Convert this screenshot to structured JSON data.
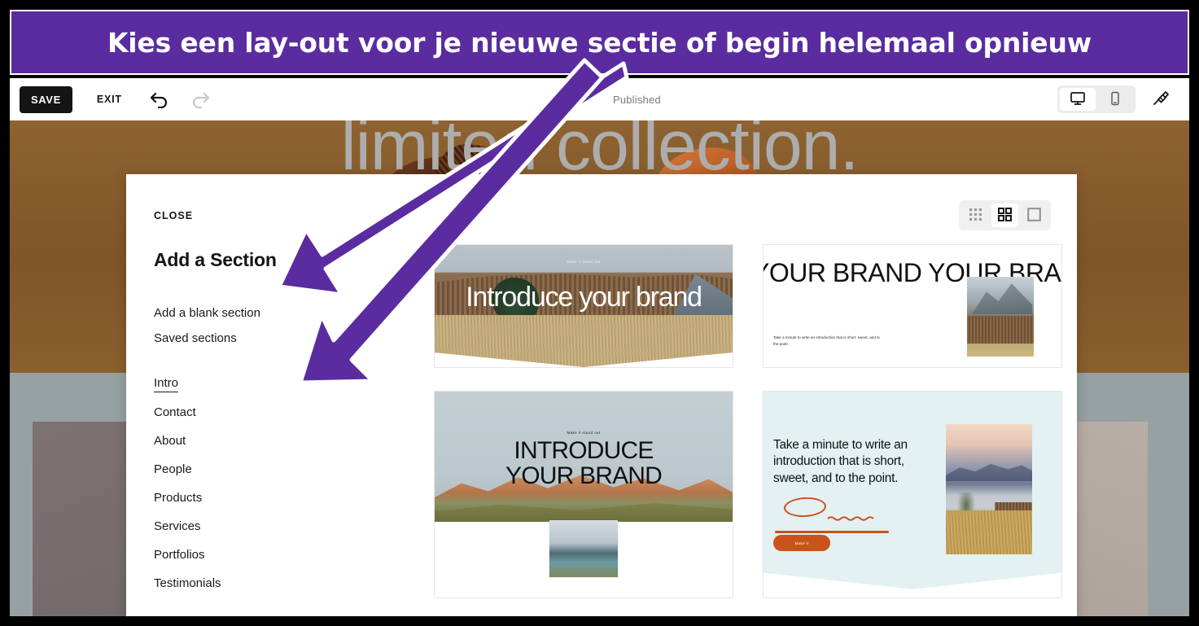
{
  "banner": {
    "text": "Kies een lay-out voor je nieuwe sectie of begin helemaal opnieuw",
    "bg_color": "#5a2ca0",
    "text_color": "#ffffff"
  },
  "annotation": {
    "color": "#5a2ca0",
    "outline_color": "#ffffff",
    "arrow_count": 2,
    "highlight_boxes": [
      "add-a-blank-section",
      "section-category-list"
    ]
  },
  "toolbar": {
    "save_label": "SAVE",
    "exit_label": "EXIT",
    "undo_icon": "undo-arrow-icon",
    "redo_icon": "redo-arrow-icon",
    "status_label": "Published",
    "devices": [
      {
        "id": "desktop",
        "icon": "desktop-monitor-icon",
        "active": true
      },
      {
        "id": "mobile",
        "icon": "mobile-phone-icon",
        "active": false
      }
    ],
    "brush_icon": "paintbrush-icon"
  },
  "canvas": {
    "hero_heading": "limited collection.",
    "hero_heading_color": "#adadad",
    "hero_bg_color": "#7f5629",
    "lower_bg_color": "#97a1a1"
  },
  "panel": {
    "close_label": "CLOSE",
    "title": "Add a Section",
    "quick_links": [
      {
        "label": "Add a blank section",
        "highlighted": true
      },
      {
        "label": "Saved sections",
        "highlighted": false
      }
    ],
    "categories": [
      {
        "label": "Intro",
        "active": true
      },
      {
        "label": "Contact",
        "active": false
      },
      {
        "label": "About",
        "active": false
      },
      {
        "label": "People",
        "active": false
      },
      {
        "label": "Products",
        "active": false
      },
      {
        "label": "Services",
        "active": false
      },
      {
        "label": "Portfolios",
        "active": false
      },
      {
        "label": "Testimonials",
        "active": false
      }
    ],
    "view_modes": [
      {
        "id": "compact",
        "icon": "grid-small-icon",
        "active": false
      },
      {
        "id": "medium",
        "icon": "grid-medium-icon",
        "active": true
      },
      {
        "id": "large",
        "icon": "single-large-icon",
        "active": false
      }
    ]
  },
  "templates": [
    {
      "id": "tpl1",
      "eyebrow": "Make it stand out",
      "headline": "Introduce your brand",
      "headline_color": "#ffffff"
    },
    {
      "id": "tpl2",
      "marquee": "YOUR BRAND  YOUR BRAN",
      "paragraph": "Take a minute to write an introduction that is short, sweet, and to the point.",
      "headline_color": "#111111"
    },
    {
      "id": "tpl3",
      "eyebrow": "Make it stand out",
      "headline": "INTRODUCE YOUR BRAND",
      "headline_color": "#111111"
    },
    {
      "id": "tpl4",
      "body": "Take a minute to write an introduction that is short, sweet, and to the point.",
      "button_label": "Make it",
      "bg_color": "#e4f1f2",
      "accent_color": "#c9531b"
    }
  ]
}
